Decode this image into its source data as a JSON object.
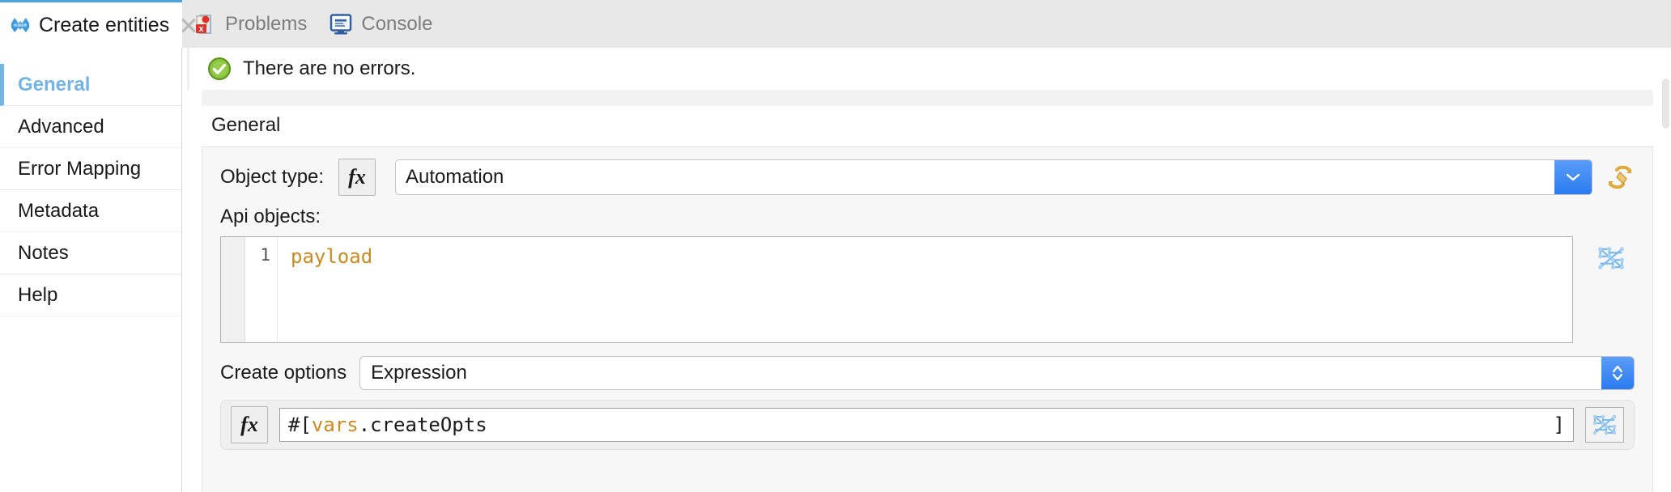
{
  "tabs": {
    "active": {
      "label": "Create entities",
      "icon": "mulesoft-logo-icon",
      "close": "close-icon"
    },
    "others": [
      {
        "label": "Problems",
        "icon": "problems-icon"
      },
      {
        "label": "Console",
        "icon": "console-icon"
      }
    ]
  },
  "sidebar": {
    "items": [
      {
        "label": "General",
        "active": true
      },
      {
        "label": "Advanced",
        "active": false
      },
      {
        "label": "Error Mapping",
        "active": false
      },
      {
        "label": "Metadata",
        "active": false
      },
      {
        "label": "Notes",
        "active": false
      },
      {
        "label": "Help",
        "active": false
      }
    ]
  },
  "status": {
    "text": "There are no errors.",
    "icon": "success-check-icon"
  },
  "general": {
    "group_title": "General",
    "object_type": {
      "label": "Object type:",
      "fx_label": "fx",
      "value": "Automation",
      "dropdown_icon": "chevron-down-icon",
      "refresh_icon": "refresh-metadata-icon"
    },
    "api_objects": {
      "label": "Api objects:",
      "line_number": "1",
      "code": "payload",
      "dw_icon": "dataweave-icon"
    },
    "create_options": {
      "label": "Create options",
      "value": "Expression",
      "stepper_icon": "stepper-updown-icon"
    },
    "expression": {
      "fx_label": "fx",
      "prefix": "#[ ",
      "token": "vars",
      "suffix": ".createOpts",
      "closing": "]",
      "dw_icon": "dataweave-icon"
    }
  },
  "colors": {
    "accent_blue": "#74b4e4",
    "button_blue": "#2a7bf0",
    "code_orange": "#c98a22",
    "success_green": "#7ab317"
  }
}
